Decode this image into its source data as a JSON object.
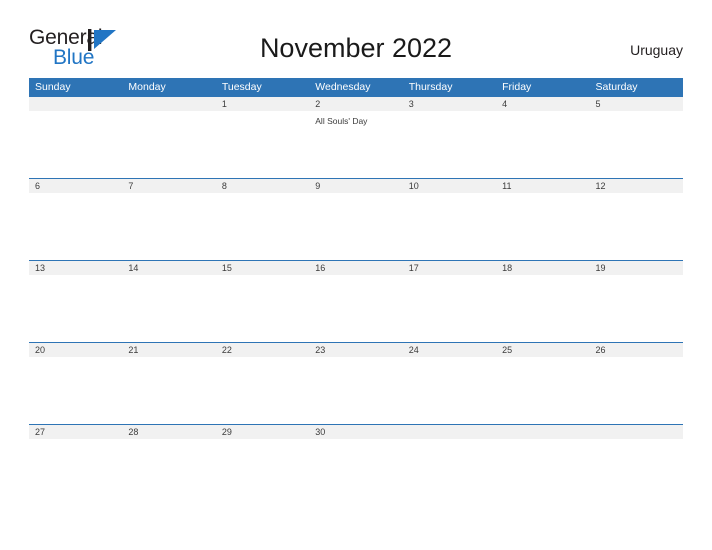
{
  "brand": {
    "name_top": "General",
    "name_bottom": "Blue",
    "mark": "triangle-logo-icon",
    "color_primary": "#2175c4",
    "color_text": "#231f20"
  },
  "header": {
    "title": "November 2022",
    "region": "Uruguay"
  },
  "theme": {
    "header_blue": "#2e74b5",
    "row_band_gray": "#f1f1f1",
    "text_dark": "#3b3b3b",
    "background": "#ffffff"
  },
  "calendar": {
    "month": "November",
    "year": "2022",
    "weekday_headers": [
      "Sunday",
      "Monday",
      "Tuesday",
      "Wednesday",
      "Thursday",
      "Friday",
      "Saturday"
    ],
    "weeks": [
      {
        "days": [
          {
            "number": "",
            "event": ""
          },
          {
            "number": "",
            "event": ""
          },
          {
            "number": "1",
            "event": ""
          },
          {
            "number": "2",
            "event": "All Souls' Day"
          },
          {
            "number": "3",
            "event": ""
          },
          {
            "number": "4",
            "event": ""
          },
          {
            "number": "5",
            "event": ""
          }
        ]
      },
      {
        "days": [
          {
            "number": "6",
            "event": ""
          },
          {
            "number": "7",
            "event": ""
          },
          {
            "number": "8",
            "event": ""
          },
          {
            "number": "9",
            "event": ""
          },
          {
            "number": "10",
            "event": ""
          },
          {
            "number": "11",
            "event": ""
          },
          {
            "number": "12",
            "event": ""
          }
        ]
      },
      {
        "days": [
          {
            "number": "13",
            "event": ""
          },
          {
            "number": "14",
            "event": ""
          },
          {
            "number": "15",
            "event": ""
          },
          {
            "number": "16",
            "event": ""
          },
          {
            "number": "17",
            "event": ""
          },
          {
            "number": "18",
            "event": ""
          },
          {
            "number": "19",
            "event": ""
          }
        ]
      },
      {
        "days": [
          {
            "number": "20",
            "event": ""
          },
          {
            "number": "21",
            "event": ""
          },
          {
            "number": "22",
            "event": ""
          },
          {
            "number": "23",
            "event": ""
          },
          {
            "number": "24",
            "event": ""
          },
          {
            "number": "25",
            "event": ""
          },
          {
            "number": "26",
            "event": ""
          }
        ]
      },
      {
        "days": [
          {
            "number": "27",
            "event": ""
          },
          {
            "number": "28",
            "event": ""
          },
          {
            "number": "29",
            "event": ""
          },
          {
            "number": "30",
            "event": ""
          },
          {
            "number": "",
            "event": ""
          },
          {
            "number": "",
            "event": ""
          },
          {
            "number": "",
            "event": ""
          }
        ]
      }
    ]
  }
}
